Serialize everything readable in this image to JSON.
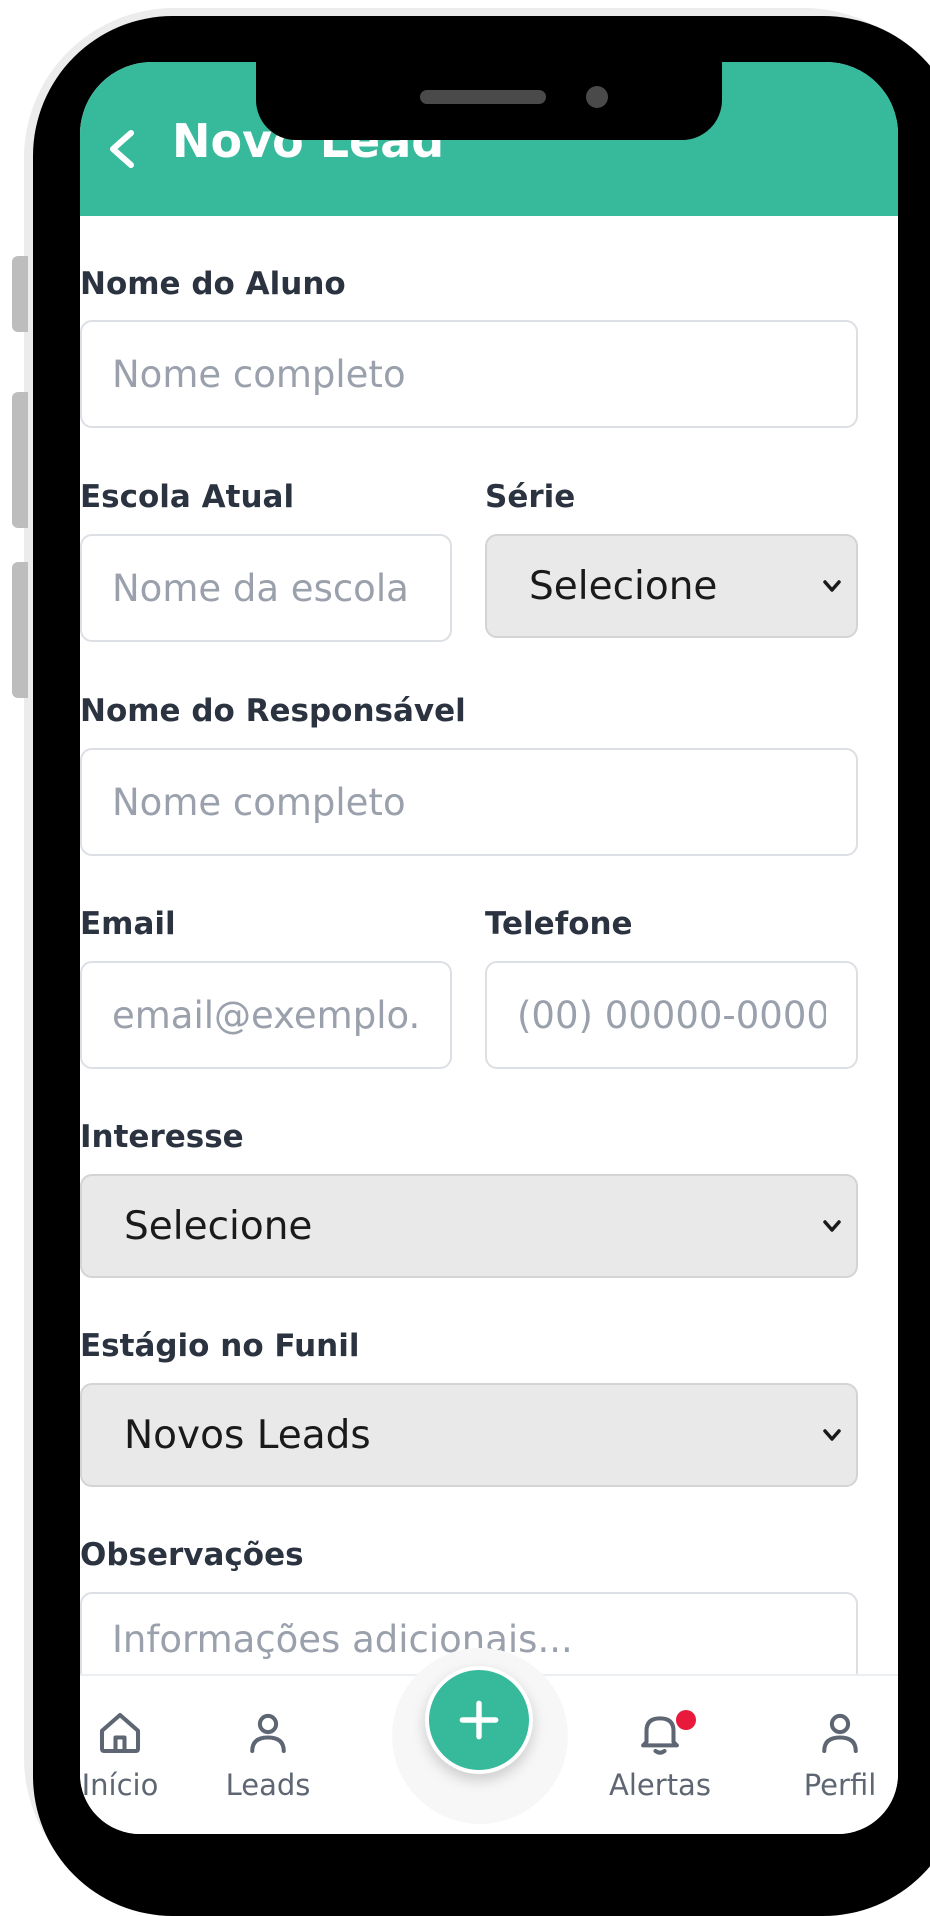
{
  "header": {
    "title": "Novo Lead",
    "back_icon": "chevron-left-icon"
  },
  "form": {
    "student_name": {
      "label": "Nome do Aluno",
      "placeholder": "Nome completo",
      "value": ""
    },
    "current_school": {
      "label": "Escola Atual",
      "placeholder": "Nome da escola",
      "value": ""
    },
    "grade": {
      "label": "Série",
      "selected": "Selecione"
    },
    "guardian_name": {
      "label": "Nome do Responsável",
      "placeholder": "Nome completo",
      "value": ""
    },
    "email": {
      "label": "Email",
      "placeholder": "email@exemplo.com",
      "value": ""
    },
    "phone": {
      "label": "Telefone",
      "placeholder": "(00) 00000-0000",
      "value": ""
    },
    "interest": {
      "label": "Interesse",
      "selected": "Selecione"
    },
    "funnel_stage": {
      "label": "Estágio no Funil",
      "selected": "Novos Leads"
    },
    "notes": {
      "label": "Observações",
      "placeholder": "Informações adicionais..."
    }
  },
  "bottom_nav": {
    "items": [
      {
        "label": "Início",
        "icon": "home-icon"
      },
      {
        "label": "Leads",
        "icon": "user-icon"
      },
      {
        "label": "Alertas",
        "icon": "bell-icon",
        "has_badge": true
      },
      {
        "label": "Perfil",
        "icon": "user-icon"
      }
    ],
    "fab_icon": "plus-icon"
  },
  "colors": {
    "accent": "#37b99c",
    "badge": "#e8193b",
    "label_text": "#2b3340",
    "placeholder_text": "#9aa1ac",
    "select_bg": "#e9e9e9"
  }
}
